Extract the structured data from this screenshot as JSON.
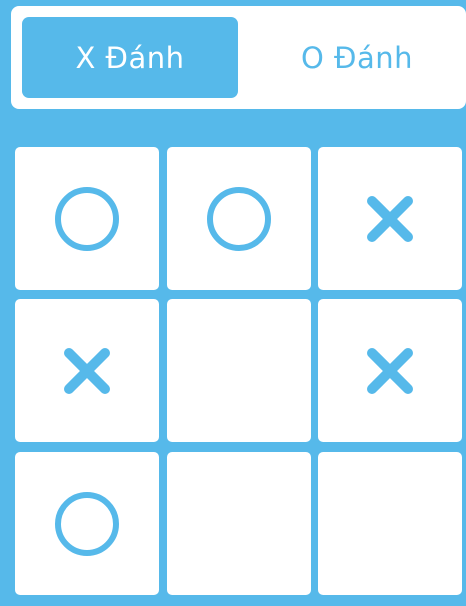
{
  "turn_selector": {
    "x_label": "X Đánh",
    "o_label": "O Đánh",
    "active": "X"
  },
  "board": [
    [
      "O",
      "O",
      "X"
    ],
    [
      "X",
      "",
      "X"
    ],
    [
      "O",
      "",
      ""
    ]
  ],
  "colors": {
    "accent": "#56b9ea",
    "cell_bg": "#ffffff"
  }
}
